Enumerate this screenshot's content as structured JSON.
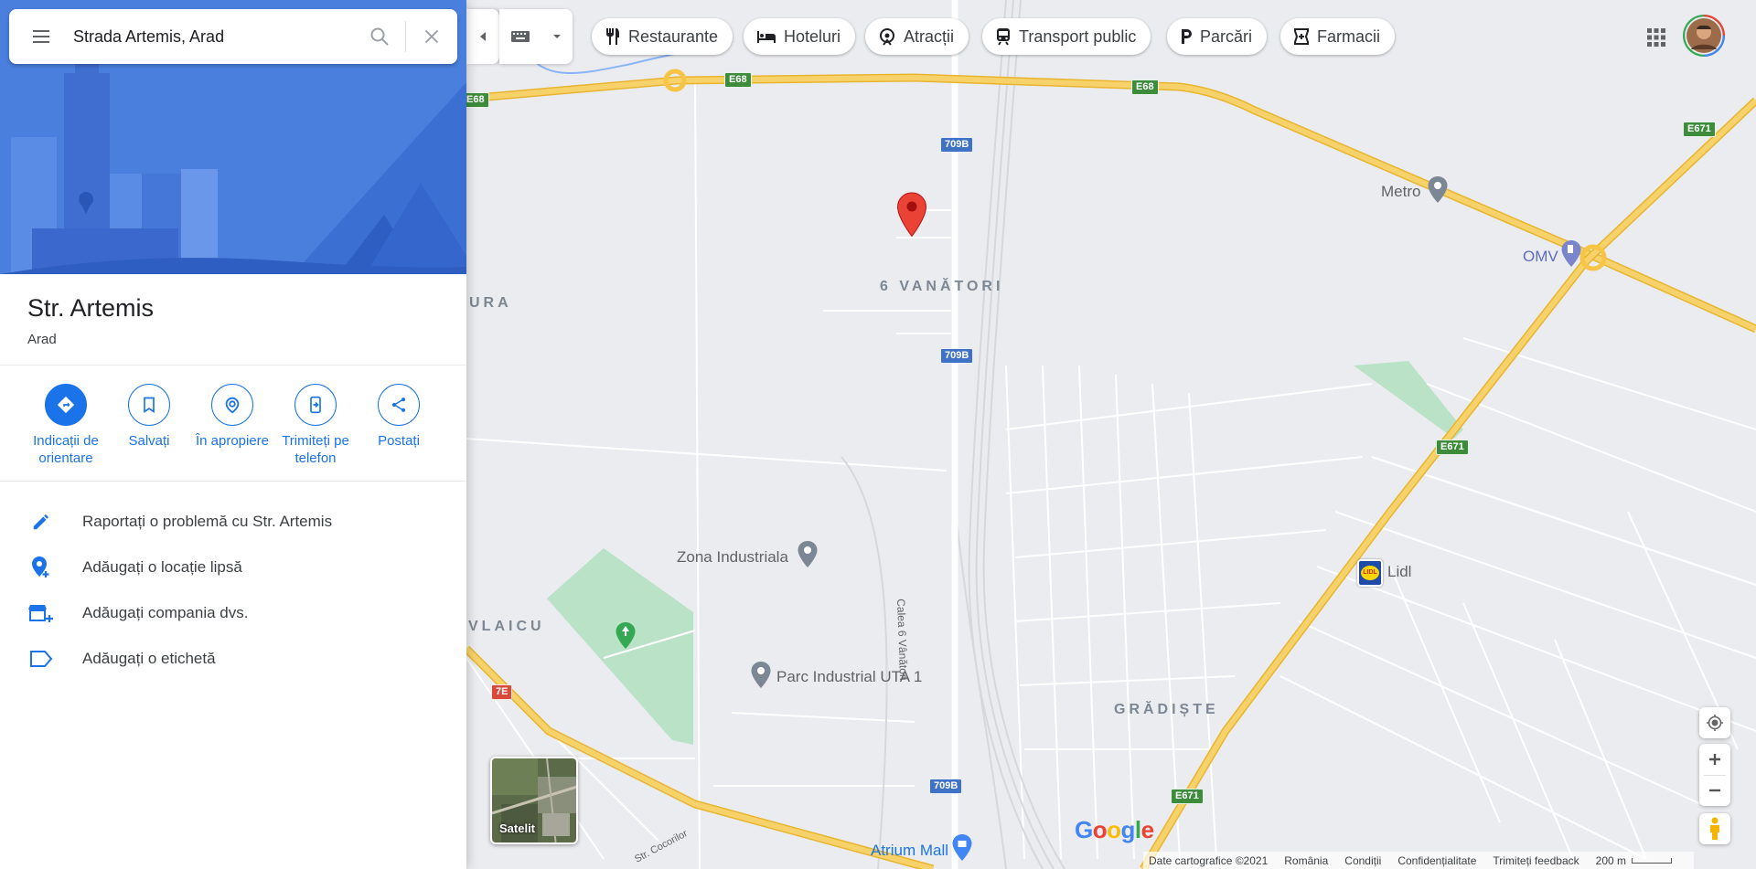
{
  "search": {
    "query": "Strada Artemis, Arad"
  },
  "place": {
    "title": "Str. Artemis",
    "subtitle": "Arad"
  },
  "actions": [
    {
      "label": "Indicații de orientare",
      "icon": "directions-icon"
    },
    {
      "label": "Salvați",
      "icon": "bookmark-icon"
    },
    {
      "label": "În apropiere",
      "icon": "nearby-icon"
    },
    {
      "label": "Trimiteți pe telefon",
      "icon": "send-to-phone-icon"
    },
    {
      "label": "Postați",
      "icon": "share-icon"
    }
  ],
  "list_items": [
    {
      "label": "Raportați o problemă cu Str. Artemis",
      "icon": "pencil-icon"
    },
    {
      "label": "Adăugați o locație lipsă",
      "icon": "add-place-icon"
    },
    {
      "label": "Adăugați compania dvs.",
      "icon": "add-business-icon"
    },
    {
      "label": "Adăugați o etichetă",
      "icon": "label-icon"
    }
  ],
  "chips": [
    {
      "label": "Restaurante",
      "icon": "restaurant-icon"
    },
    {
      "label": "Hoteluri",
      "icon": "hotel-icon"
    },
    {
      "label": "Atracții",
      "icon": "attraction-icon"
    },
    {
      "label": "Transport public",
      "icon": "transit-icon"
    },
    {
      "label": "Parcări",
      "icon": "parking-icon"
    },
    {
      "label": "Farmacii",
      "icon": "pharmacy-icon"
    }
  ],
  "map": {
    "area_labels": [
      "6 VANĂTORI",
      "URA",
      "VLAICU",
      "GRĂDIȘTE"
    ],
    "poi_labels": [
      "Metro",
      "OMV",
      "Lidl",
      "Zona Industriala",
      "Parc Industrial UTA 1",
      "Atrium Mall"
    ],
    "road_shields": [
      "E68",
      "E68",
      "E68",
      "709B",
      "709B",
      "709B",
      "E671",
      "E671",
      "E671",
      "7E"
    ],
    "street_labels": [
      "Calea 6 Vânători",
      "Str. Cocorilor"
    ],
    "lidl_logo_text": "LIDL"
  },
  "satellite": {
    "label": "Satelit"
  },
  "google_logo": "Google",
  "footer": {
    "data": "Date cartografice ©2021",
    "country": "România",
    "terms": "Condiții",
    "privacy": "Confidențialitate",
    "feedback": "Trimiteți feedback",
    "scale": "200 m"
  },
  "colors": {
    "accent": "#1a73e8",
    "highway": "#f7c443",
    "park": "#b9e2c6",
    "pin": "#ea4335",
    "hero": "#4a7fde"
  }
}
